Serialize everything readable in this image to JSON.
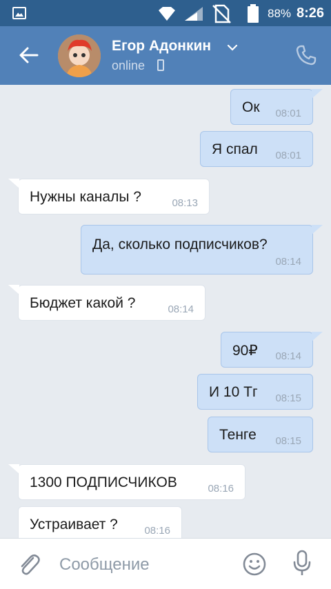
{
  "status_bar": {
    "battery_percent": "88%",
    "time": "8:26",
    "icons": [
      "gallery-icon",
      "diamond-signal-icon",
      "cell-signal-icon",
      "no-sim-icon",
      "battery-icon"
    ]
  },
  "header": {
    "contact_name": "Егор Адонкин",
    "presence": "online",
    "icons": [
      "back-arrow-icon",
      "chevron-down-icon",
      "mobile-icon",
      "phone-icon"
    ]
  },
  "messages": [
    {
      "direction": "out",
      "text": "Ок",
      "time": "08:01"
    },
    {
      "direction": "out",
      "text": "Я спал",
      "time": "08:01"
    },
    {
      "direction": "in",
      "text": "Нужны каналы ?",
      "time": "08:13"
    },
    {
      "direction": "out",
      "text": "Да, сколько подписчиков?",
      "time": "08:14"
    },
    {
      "direction": "in",
      "text": "Бюджет какой ?",
      "time": "08:14"
    },
    {
      "direction": "out",
      "text": "90₽",
      "time": "08:14"
    },
    {
      "direction": "out",
      "text": "И 10 Тг",
      "time": "08:15"
    },
    {
      "direction": "out",
      "text": "Тенге",
      "time": "08:15"
    },
    {
      "direction": "in",
      "text": "1300 ПОДПИСЧИКОВ",
      "time": "08:16"
    },
    {
      "direction": "in",
      "text": "Устраивает ?",
      "time": "08:16"
    }
  ],
  "composer": {
    "placeholder": "Сообщение",
    "icons": [
      "attach-icon",
      "emoji-icon",
      "mic-icon"
    ]
  },
  "colors": {
    "status_bar": "#2e5f8e",
    "header": "#5181b8",
    "chat_background": "#e7ebf0",
    "outgoing_bubble": "#cde0f7",
    "incoming_bubble": "#ffffff"
  }
}
